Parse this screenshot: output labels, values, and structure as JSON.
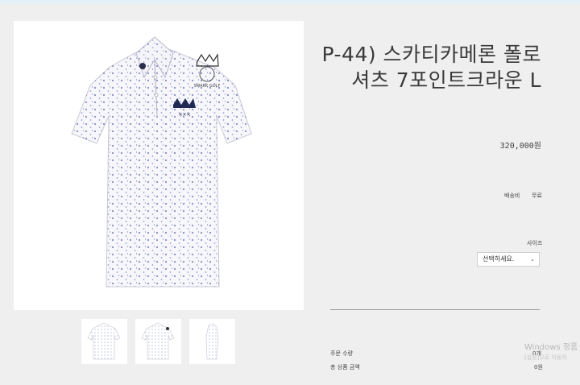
{
  "product": {
    "title_line1": "P-44) 스카티카메론 폴로",
    "title_line2": "셔츠 7포인트크라운 L",
    "price": "320,000원",
    "brand_mark": "SMARK GOLF"
  },
  "shipping": {
    "label": "배송비",
    "value": "무료"
  },
  "size": {
    "label": "사이즈",
    "selected": "선택하세요."
  },
  "order": {
    "quantity_label": "주문 수량",
    "quantity_value": "0개",
    "total_label": "총 상품 금액",
    "total_value": "0원"
  },
  "watermark": {
    "line1": "Windows 정품",
    "line2": "[설정]으로 이동하"
  },
  "colors": {
    "background": "#efefef",
    "shirt_pattern": "#6b7ab8",
    "accent_bar": "#e4f1f8"
  },
  "icons": {
    "chevron": "chevron-down-icon"
  }
}
